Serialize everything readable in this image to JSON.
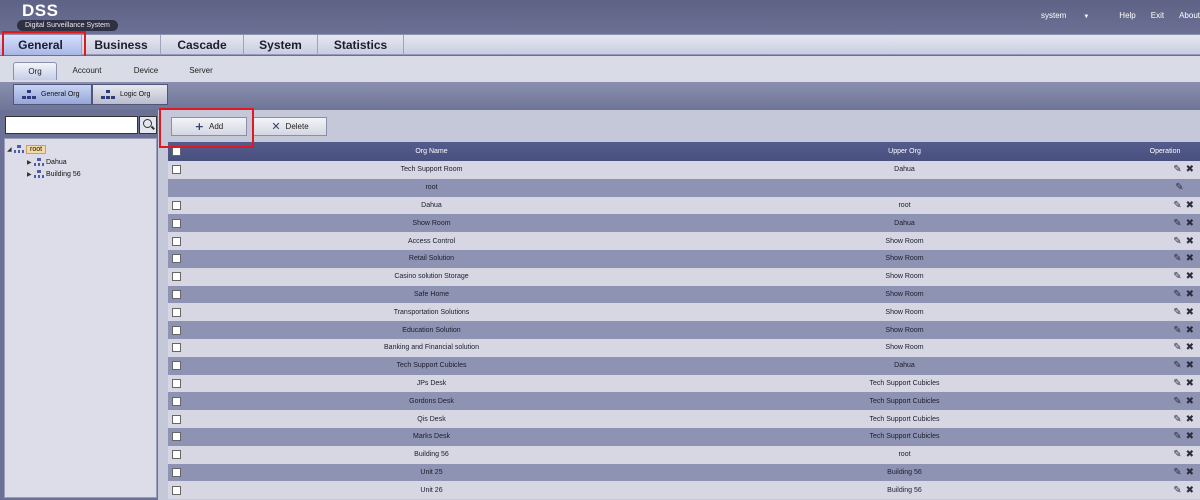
{
  "app": {
    "name": "DSS",
    "subtitle": "Digital Surveillance System",
    "top_links": {
      "user": "system",
      "help": "Help",
      "exit": "Exit",
      "about": "About"
    }
  },
  "main_tabs": [
    "General",
    "Business",
    "Cascade",
    "System",
    "Statistics"
  ],
  "sub_tabs": [
    "Org",
    "Account",
    "Device",
    "Server"
  ],
  "view_toggle": {
    "general": "General Org",
    "logic": "Logic Org"
  },
  "search": {
    "placeholder": "",
    "value": ""
  },
  "tree": {
    "root": "root",
    "children": [
      "Dahua",
      "Building 56"
    ]
  },
  "toolbar": {
    "add": "Add",
    "delete": "Delete"
  },
  "table": {
    "columns": {
      "org_name": "Org Name",
      "upper_org": "Upper Org",
      "operation": "Operation"
    },
    "rows": [
      {
        "name": "Tech Support Room",
        "upper": "Dahua",
        "checkbox": true,
        "delete": true
      },
      {
        "name": "root",
        "upper": "",
        "checkbox": false,
        "delete": false
      },
      {
        "name": "Dahua",
        "upper": "root",
        "checkbox": true,
        "delete": true
      },
      {
        "name": "Show Room",
        "upper": "Dahua",
        "checkbox": true,
        "delete": true
      },
      {
        "name": "Access Control",
        "upper": "Show Room",
        "checkbox": true,
        "delete": true
      },
      {
        "name": "Retail Solution",
        "upper": "Show Room",
        "checkbox": true,
        "delete": true
      },
      {
        "name": "Casino solution Storage",
        "upper": "Show Room",
        "checkbox": true,
        "delete": true
      },
      {
        "name": "Safe Home",
        "upper": "Show Room",
        "checkbox": true,
        "delete": true
      },
      {
        "name": "Transportation Solutions",
        "upper": "Show Room",
        "checkbox": true,
        "delete": true
      },
      {
        "name": "Education Solution",
        "upper": "Show Room",
        "checkbox": true,
        "delete": true
      },
      {
        "name": "Banking and Financial solution",
        "upper": "Show Room",
        "checkbox": true,
        "delete": true
      },
      {
        "name": "Tech Support Cubicles",
        "upper": "Dahua",
        "checkbox": true,
        "delete": true
      },
      {
        "name": "JPs Desk",
        "upper": "Tech Support Cubicles",
        "checkbox": true,
        "delete": true
      },
      {
        "name": "Gordons Desk",
        "upper": "Tech Support Cubicles",
        "checkbox": true,
        "delete": true
      },
      {
        "name": "Qis Desk",
        "upper": "Tech Support Cubicles",
        "checkbox": true,
        "delete": true
      },
      {
        "name": "Marks Desk",
        "upper": "Tech Support Cubicles",
        "checkbox": true,
        "delete": true
      },
      {
        "name": "Building 56",
        "upper": "root",
        "checkbox": true,
        "delete": true
      },
      {
        "name": "Unit 25",
        "upper": "Building 56",
        "checkbox": true,
        "delete": true
      },
      {
        "name": "Unit 26",
        "upper": "Building 56",
        "checkbox": true,
        "delete": true
      }
    ]
  },
  "colors": {
    "highlight": "#e0191e",
    "header_bg": "#4f5687",
    "active_tab": "#a8b6e4"
  },
  "icons": {
    "search": "magnifier",
    "edit": "pencil",
    "delete": "x-mark",
    "add": "plus",
    "org": "org-tree"
  }
}
